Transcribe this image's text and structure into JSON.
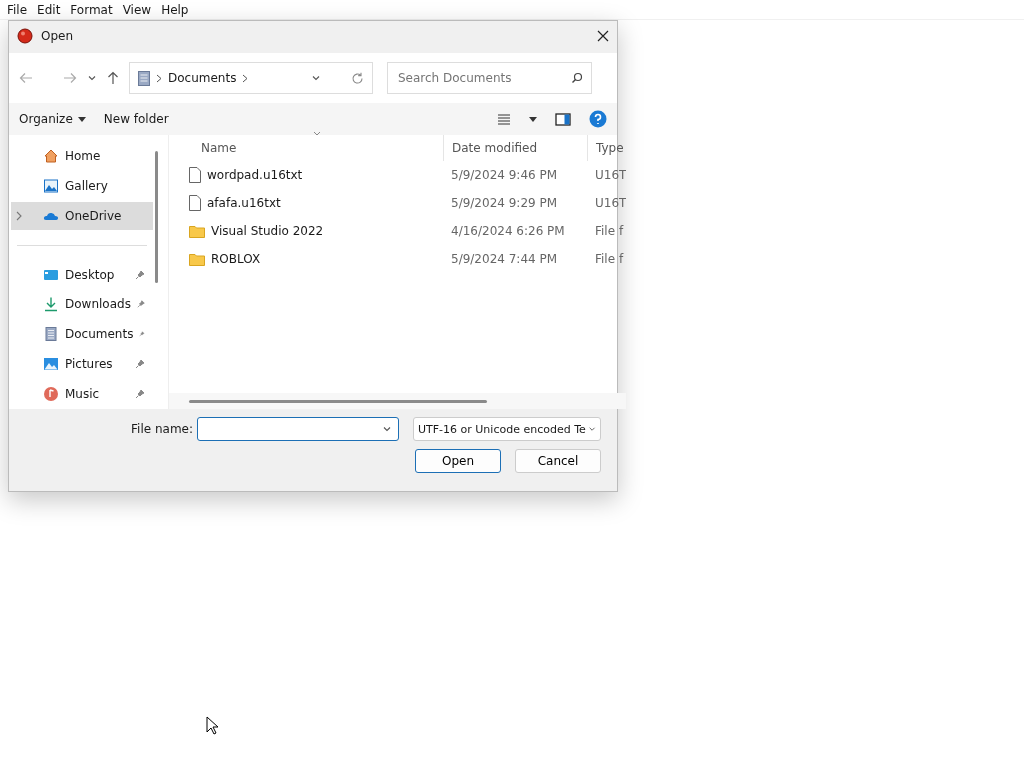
{
  "menu_bar": [
    "File",
    "Edit",
    "Format",
    "View",
    "Help"
  ],
  "dialog": {
    "title": "Open",
    "address": {
      "crumbs": [
        "Documents"
      ]
    },
    "search": {
      "placeholder": "Search Documents"
    },
    "commands": {
      "organize": "Organize",
      "new_folder": "New folder"
    },
    "nav_items": [
      {
        "label": "Home",
        "kind": "home",
        "pinned": false,
        "selected": false,
        "expandable": false
      },
      {
        "label": "Gallery",
        "kind": "gallery",
        "pinned": false,
        "selected": false,
        "expandable": false
      },
      {
        "label": "OneDrive",
        "kind": "cloud",
        "pinned": false,
        "selected": true,
        "expandable": true
      }
    ],
    "quick_access": [
      {
        "label": "Desktop",
        "kind": "desktop",
        "pinned": true,
        "selected": false,
        "expandable": false
      },
      {
        "label": "Downloads",
        "kind": "downloads",
        "pinned": true,
        "selected": false,
        "expandable": false
      },
      {
        "label": "Documents",
        "kind": "documents",
        "pinned": true,
        "selected": false,
        "expandable": false
      },
      {
        "label": "Pictures",
        "kind": "pictures",
        "pinned": true,
        "selected": false,
        "expandable": false
      },
      {
        "label": "Music",
        "kind": "music",
        "pinned": true,
        "selected": false,
        "expandable": false
      }
    ],
    "columns": [
      "Name",
      "Date modified",
      "Type"
    ],
    "files": [
      {
        "name": "wordpad.u16txt",
        "kind": "file",
        "date": "5/9/2024 9:46 PM",
        "type": "U16T"
      },
      {
        "name": "afafa.u16txt",
        "kind": "file",
        "date": "5/9/2024 9:29 PM",
        "type": "U16T"
      },
      {
        "name": "Visual Studio 2022",
        "kind": "folder",
        "date": "4/16/2024 6:26 PM",
        "type": "File f"
      },
      {
        "name": "ROBLOX",
        "kind": "folder",
        "date": "5/9/2024 7:44 PM",
        "type": "File f"
      }
    ],
    "file_name": {
      "label": "File name:"
    },
    "file_type": "UTF-16 or Unicode encoded Te",
    "buttons": [
      {
        "label": "Open",
        "default": true
      },
      {
        "label": "Cancel",
        "default": false
      }
    ]
  }
}
